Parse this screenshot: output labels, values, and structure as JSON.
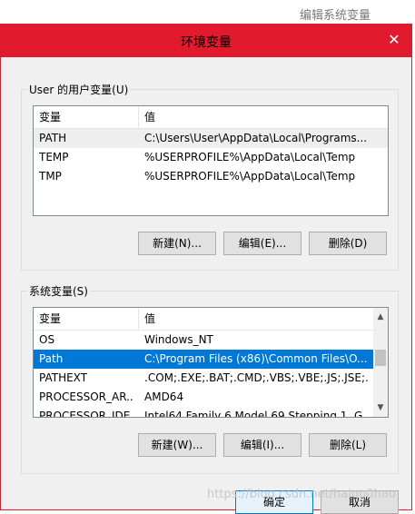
{
  "background": {
    "text": "编辑系统变量"
  },
  "dialog": {
    "title": "环境变量",
    "close_glyph": "✕"
  },
  "user_vars": {
    "label": "User 的用户变量(U)",
    "columns": [
      "变量",
      "值"
    ],
    "rows": [
      {
        "name": "PATH",
        "value": "C:\\Users\\User\\AppData\\Local\\Programs..."
      },
      {
        "name": "TEMP",
        "value": "%USERPROFILE%\\AppData\\Local\\Temp"
      },
      {
        "name": "TMP",
        "value": "%USERPROFILE%\\AppData\\Local\\Temp"
      }
    ],
    "buttons": {
      "new": "新建(N)...",
      "edit": "编辑(E)...",
      "delete": "删除(D)"
    }
  },
  "system_vars": {
    "label": "系统变量(S)",
    "columns": [
      "变量",
      "值"
    ],
    "rows": [
      {
        "name": "OS",
        "value": "Windows_NT"
      },
      {
        "name": "Path",
        "value": "C:\\Program Files (x86)\\Common Files\\O..."
      },
      {
        "name": "PATHEXT",
        "value": ".COM;.EXE;.BAT;.CMD;.VBS;.VBE;.JS;.JSE;..."
      },
      {
        "name": "PROCESSOR_AR...",
        "value": "AMD64"
      },
      {
        "name": "PROCESSOR_IDE...",
        "value": "Intel64 Family 6 Model 69 Stepping 1, G..."
      }
    ],
    "selected_row": 1,
    "buttons": {
      "new": "新建(W)...",
      "edit": "编辑(I)...",
      "delete": "删除(L)"
    }
  },
  "footer": {
    "ok": "确定",
    "cancel": "取消"
  },
  "watermark": "https://blog.csdn.net/haiqu0hao",
  "colors": {
    "accent": "#e21a2e",
    "selection": "#0078d7"
  }
}
